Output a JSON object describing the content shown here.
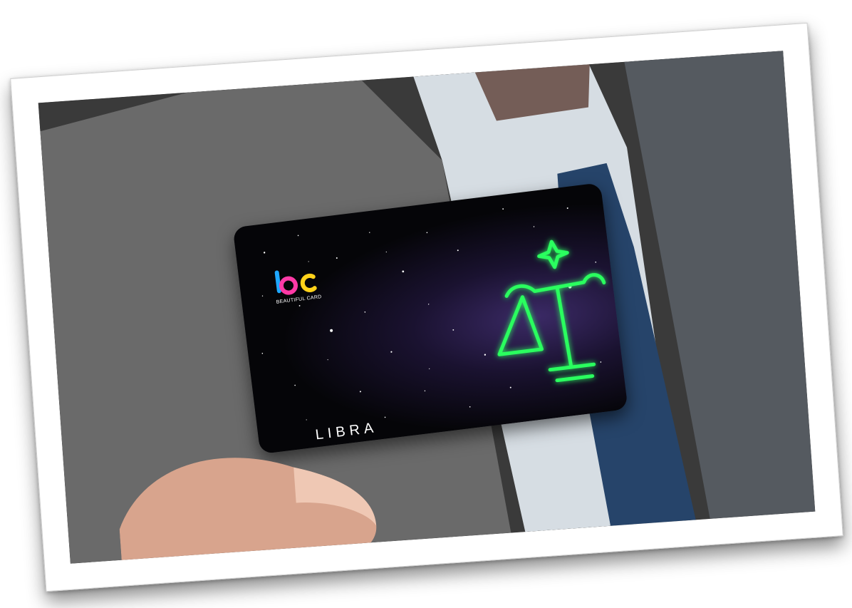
{
  "card": {
    "logo_text": "BEAUTIFUL CARD",
    "name": "LIBRA",
    "accent_green": "#2bff5e",
    "logo_colors": [
      "#1ea7ff",
      "#ff3aa6",
      "#ffd21a"
    ]
  },
  "scene": {
    "icons": [
      "libra-constellation-icon",
      "bc-logo-icon",
      "star-icon"
    ]
  }
}
